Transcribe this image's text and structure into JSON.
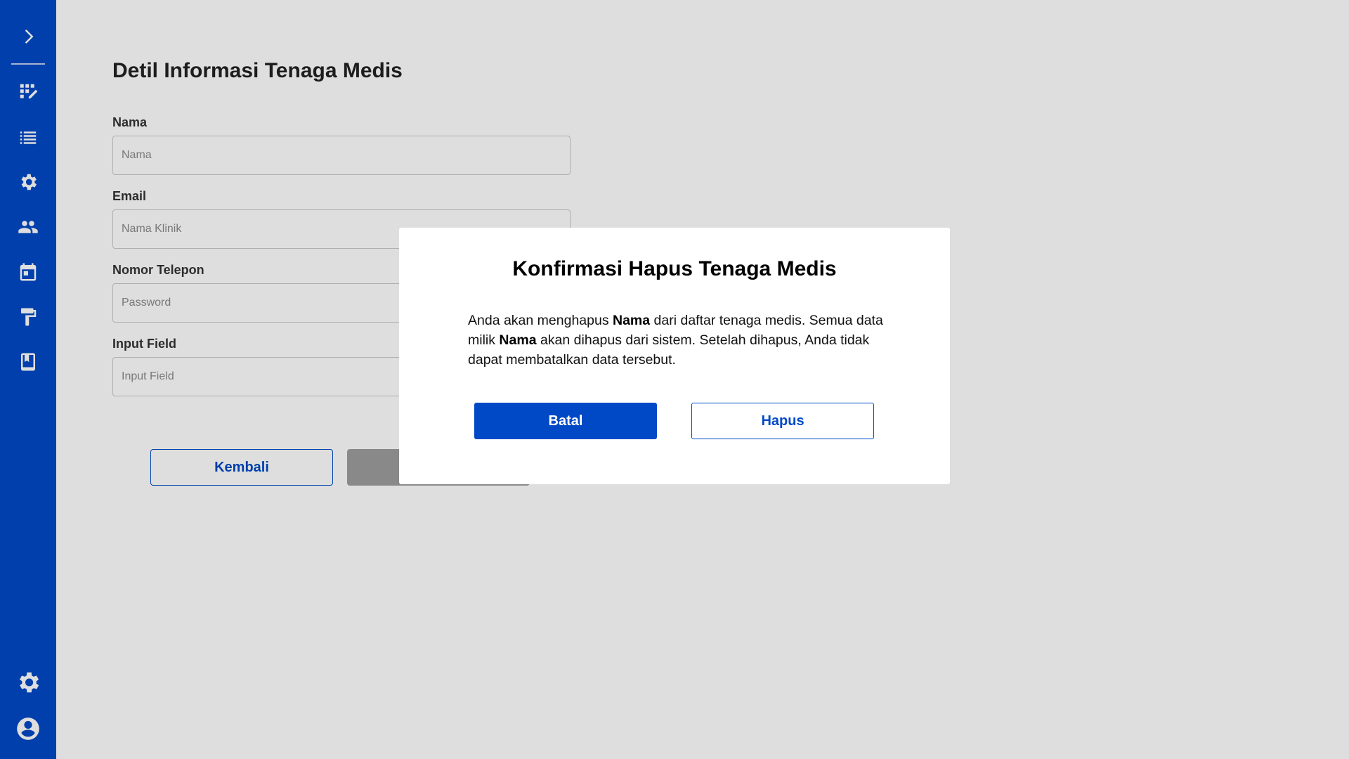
{
  "sidebar": {
    "icons": [
      "chevron-right-icon",
      "edit-grid-icon",
      "list-icon",
      "settings-icon",
      "people-icon",
      "calendar-icon",
      "paint-roller-icon",
      "book-icon",
      "settings-icon",
      "account-icon"
    ]
  },
  "page": {
    "title": "Detil Informasi Tenaga Medis",
    "fields": [
      {
        "label": "Nama",
        "placeholder": "Nama"
      },
      {
        "label": "Email",
        "placeholder": "Nama Klinik"
      },
      {
        "label": "Nomor Telepon",
        "placeholder": "Password"
      },
      {
        "label": "Input Field",
        "placeholder": "Input Field"
      }
    ],
    "back_button": "Kembali"
  },
  "modal": {
    "title": "Konfirmasi Hapus Tenaga Medis",
    "body_part1": "Anda akan menghapus ",
    "name_bold": "Nama",
    "body_part2": " dari daftar tenaga medis. Semua data milik ",
    "body_part3": " akan dihapus dari sistem. Setelah dihapus, Anda tidak dapat membatalkan data tersebut.",
    "cancel_label": "Batal",
    "delete_label": "Hapus"
  },
  "colors": {
    "primary": "#0049c6",
    "overlay": "rgba(0,0,0,0.13)",
    "disabled": "#9e9e9e"
  }
}
